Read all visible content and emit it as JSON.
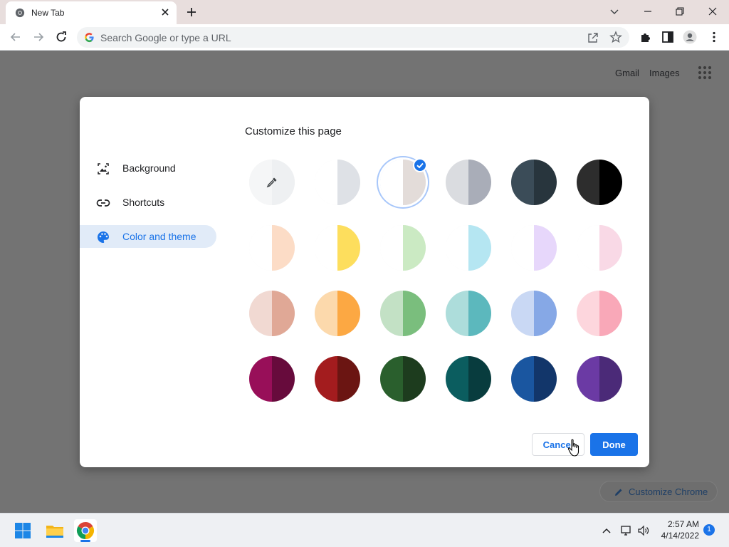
{
  "browser": {
    "tab_title": "New Tab",
    "omnibox_placeholder": "Search Google or type a URL"
  },
  "page": {
    "links": [
      "Gmail",
      "Images"
    ],
    "customize_chrome_label": "Customize Chrome"
  },
  "dialog": {
    "title": "Customize this page",
    "nav": [
      {
        "label": "Background",
        "icon": "image-icon",
        "active": false
      },
      {
        "label": "Shortcuts",
        "icon": "link-icon",
        "active": false
      },
      {
        "label": "Color and theme",
        "icon": "palette-icon",
        "active": true
      }
    ],
    "swatches": [
      {
        "name": "custom-color",
        "left": "#f5f6f7",
        "right": "#eef0f2",
        "custom": true
      },
      {
        "name": "default-light",
        "left": "#ffffff",
        "right": "#dee1e6"
      },
      {
        "name": "warm-grey",
        "left": "#ffffff",
        "right": "#e3dcd9",
        "selected": true
      },
      {
        "name": "cool-grey",
        "left": "#dadce0",
        "right": "#a9adb8"
      },
      {
        "name": "midnight-blue",
        "left": "#3b4c58",
        "right": "#28353d"
      },
      {
        "name": "black",
        "left": "#2d2d2d",
        "right": "#000000"
      },
      {
        "name": "beige-white",
        "left": "#ffffff",
        "right": "#fcdcc6"
      },
      {
        "name": "yellow-white",
        "left": "#ffffff",
        "right": "#fdde5d"
      },
      {
        "name": "green-white",
        "left": "#ffffff",
        "right": "#cbeac3"
      },
      {
        "name": "light-teal-white",
        "left": "#ffffff",
        "right": "#b5e6f2"
      },
      {
        "name": "light-purple-white",
        "left": "#ffffff",
        "right": "#e7d7fb"
      },
      {
        "name": "pink-white",
        "left": "#ffffff",
        "right": "#f9d9e6"
      },
      {
        "name": "beige",
        "left": "#f1d9d2",
        "right": "#e0a896"
      },
      {
        "name": "orange",
        "left": "#fcd9ac",
        "right": "#fca843"
      },
      {
        "name": "light-green",
        "left": "#c3e1c5",
        "right": "#7abe7d"
      },
      {
        "name": "light-teal",
        "left": "#addddb",
        "right": "#5cb8bd"
      },
      {
        "name": "light-blue",
        "left": "#c9d8f4",
        "right": "#86a8e6"
      },
      {
        "name": "light-pink",
        "left": "#fdd6dd",
        "right": "#f9a8b8"
      },
      {
        "name": "dark-pink-red",
        "left": "#980f59",
        "right": "#670b3c"
      },
      {
        "name": "dark-red-orange",
        "left": "#a31c1e",
        "right": "#6b1512"
      },
      {
        "name": "dark-green",
        "left": "#2a5f2d",
        "right": "#1d3c1e"
      },
      {
        "name": "dark-teal",
        "left": "#0b5d5f",
        "right": "#083c3e"
      },
      {
        "name": "dark-blue",
        "left": "#1a56a0",
        "right": "#12366a"
      },
      {
        "name": "purple",
        "left": "#6b3aa4",
        "right": "#4b2a78"
      }
    ],
    "cancel_label": "Cancel",
    "done_label": "Done"
  },
  "taskbar": {
    "time": "2:57 AM",
    "date": "4/14/2022",
    "notification_count": "1"
  },
  "colors": {
    "accent": "#1a73e8",
    "overlay": "#737373",
    "titlebar": "#e8dedd"
  }
}
